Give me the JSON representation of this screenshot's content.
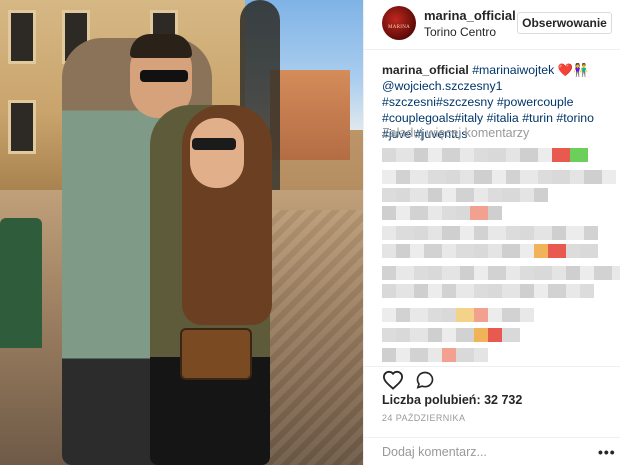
{
  "post": {
    "photo_alt": "photo",
    "username": "marina_official",
    "location": "Torino Centro",
    "follow_label": "Obserwowanie",
    "avatar_text": "MARINA",
    "caption": {
      "username": "marina_official",
      "parts": [
        {
          "text": "#marinaiwojtek",
          "type": "tag"
        },
        {
          "text": " ❤️👫",
          "type": "emoji"
        },
        {
          "text": "@wojciech.szczesny1",
          "type": "tag"
        },
        {
          "text": " ",
          "type": "text"
        },
        {
          "text": "#szczesni",
          "type": "tag"
        },
        {
          "text": "#szczesny",
          "type": "tag"
        },
        {
          "text": " ",
          "type": "text"
        },
        {
          "text": "#powercouple",
          "type": "tag"
        },
        {
          "text": " ",
          "type": "text"
        },
        {
          "text": "#couplegoals",
          "type": "tag"
        },
        {
          "text": "#italy",
          "type": "tag"
        },
        {
          "text": " ",
          "type": "text"
        },
        {
          "text": "#italia",
          "type": "tag"
        },
        {
          "text": " ",
          "type": "text"
        },
        {
          "text": "#turin",
          "type": "tag"
        },
        {
          "text": " ",
          "type": "text"
        },
        {
          "text": "#torino",
          "type": "tag"
        },
        {
          "text": " ",
          "type": "text"
        },
        {
          "text": "#juve",
          "type": "tag"
        },
        {
          "text": " ",
          "type": "text"
        },
        {
          "text": "#juventus",
          "type": "tag"
        }
      ]
    },
    "load_more": "Załaduj więcej komentarzy",
    "likes_label": "Liczba polubień: 32 732",
    "date": "24 PAŹDZIERNIKA",
    "comment_placeholder": "Dodaj komentarz...",
    "more_label": "•••"
  },
  "icons": {
    "like": "heart-icon",
    "comment": "comment-icon",
    "more": "more-options-icon"
  },
  "colors": {
    "tag": "#003569",
    "muted": "#999999",
    "text": "#262626",
    "border": "#efefef"
  }
}
